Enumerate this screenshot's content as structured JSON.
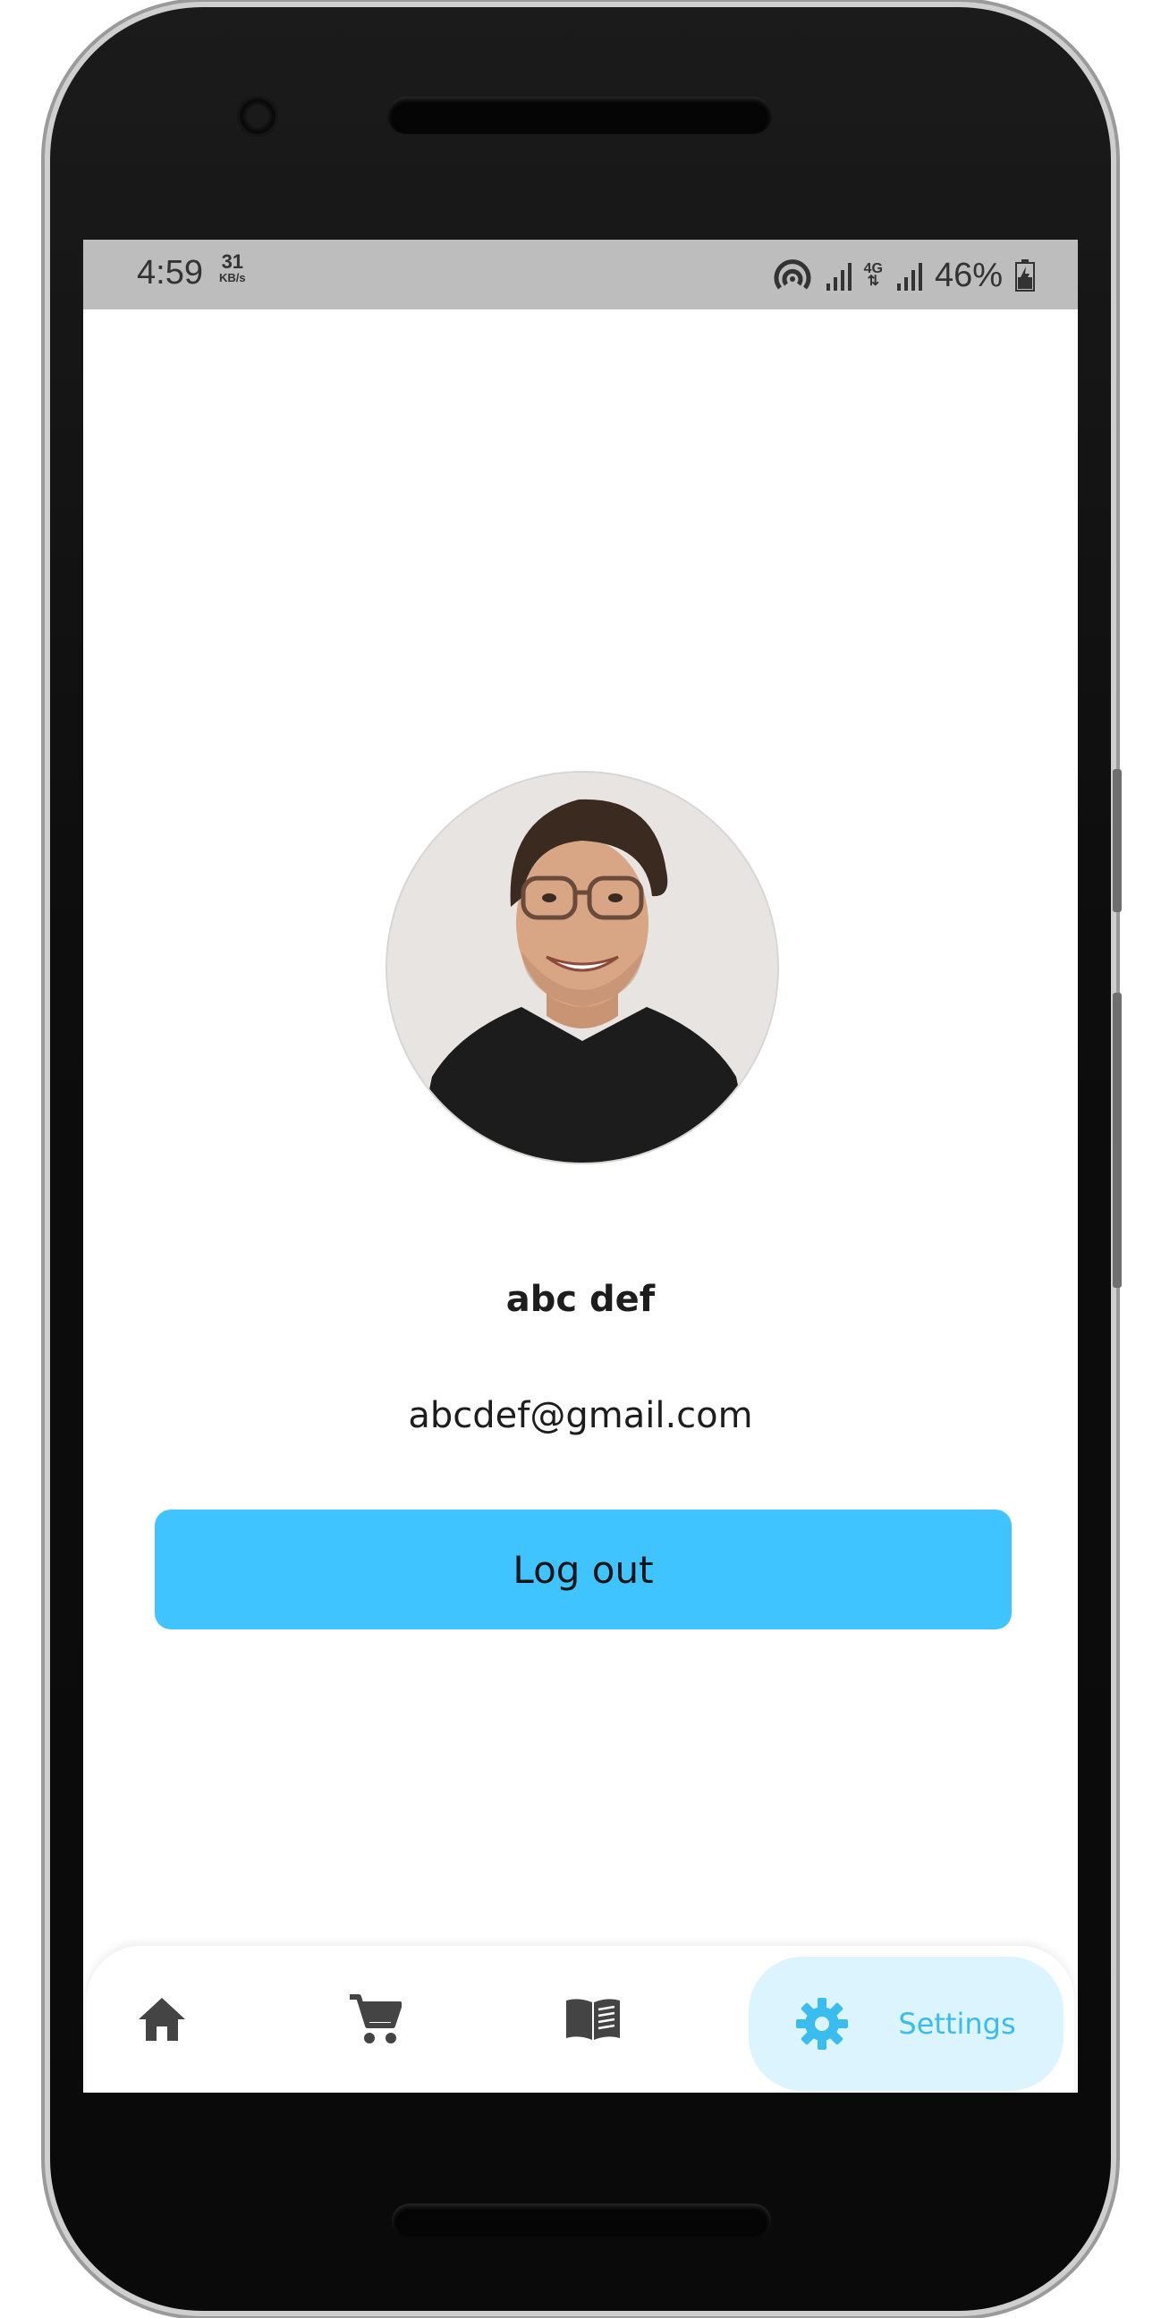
{
  "status_bar": {
    "time": "4:59",
    "net_speed_value": "31",
    "net_speed_unit": "KB/s",
    "network_type": "4G",
    "battery": "46%"
  },
  "profile": {
    "name": "abc def",
    "email": "abcdef@gmail.com"
  },
  "actions": {
    "logout_label": "Log out"
  },
  "bottom_nav": {
    "items": [
      {
        "icon": "home-icon",
        "active": false
      },
      {
        "icon": "cart-icon",
        "active": false
      },
      {
        "icon": "book-icon",
        "active": false
      },
      {
        "icon": "gear-icon",
        "label": "Settings",
        "active": true
      }
    ]
  },
  "colors": {
    "accent": "#40c4ff",
    "active_nav_bg": "#dcf4fe",
    "active_nav_fg": "#3bbcef",
    "inactive_icon": "#444444",
    "status_bar": "#bdbdbd"
  }
}
